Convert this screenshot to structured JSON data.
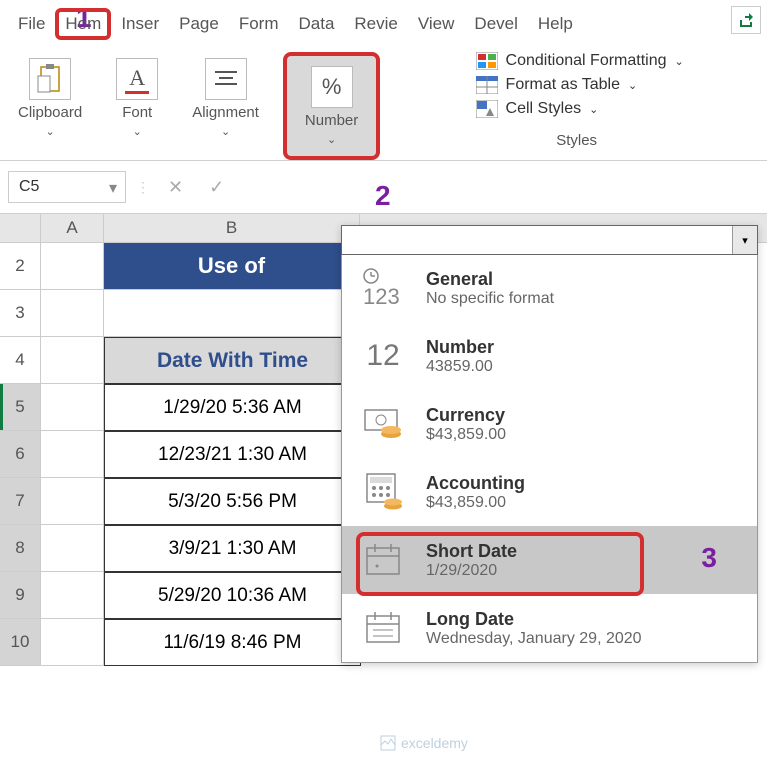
{
  "menubar": {
    "items": [
      "File",
      "Hom",
      "Inser",
      "Page",
      "Form",
      "Data",
      "Revie",
      "View",
      "Devel",
      "Help"
    ]
  },
  "callouts": {
    "one": "1",
    "two": "2",
    "three": "3"
  },
  "ribbon": {
    "clipboard": "Clipboard",
    "font": "Font",
    "alignment": "Alignment",
    "number": "Number",
    "conditional": "Conditional Formatting",
    "format_table": "Format as Table",
    "cell_styles": "Cell Styles",
    "styles_label": "Styles"
  },
  "namebox": {
    "value": "C5"
  },
  "columns": {
    "A": "A",
    "B": "B"
  },
  "rows": [
    "2",
    "3",
    "4",
    "5",
    "6",
    "7",
    "8",
    "9",
    "10"
  ],
  "sheet": {
    "title": "Use of",
    "header": "Date With Time",
    "data": [
      "1/29/20 5:36 AM",
      "12/23/21 1:30 AM",
      "5/3/20 5:56 PM",
      "3/9/21 1:30 AM",
      "5/29/20 10:36 AM",
      "11/6/19 8:46 PM"
    ]
  },
  "dropdown": {
    "input": "",
    "items": [
      {
        "title": "General",
        "sub": "No specific format"
      },
      {
        "title": "Number",
        "sub": "43859.00"
      },
      {
        "title": "Currency",
        "sub": "$43,859.00"
      },
      {
        "title": "Accounting",
        "sub": " $43,859.00"
      },
      {
        "title": "Short Date",
        "sub": "1/29/2020"
      },
      {
        "title": "Long Date",
        "sub": "Wednesday, January 29, 2020"
      }
    ]
  },
  "watermark": "exceldemy"
}
